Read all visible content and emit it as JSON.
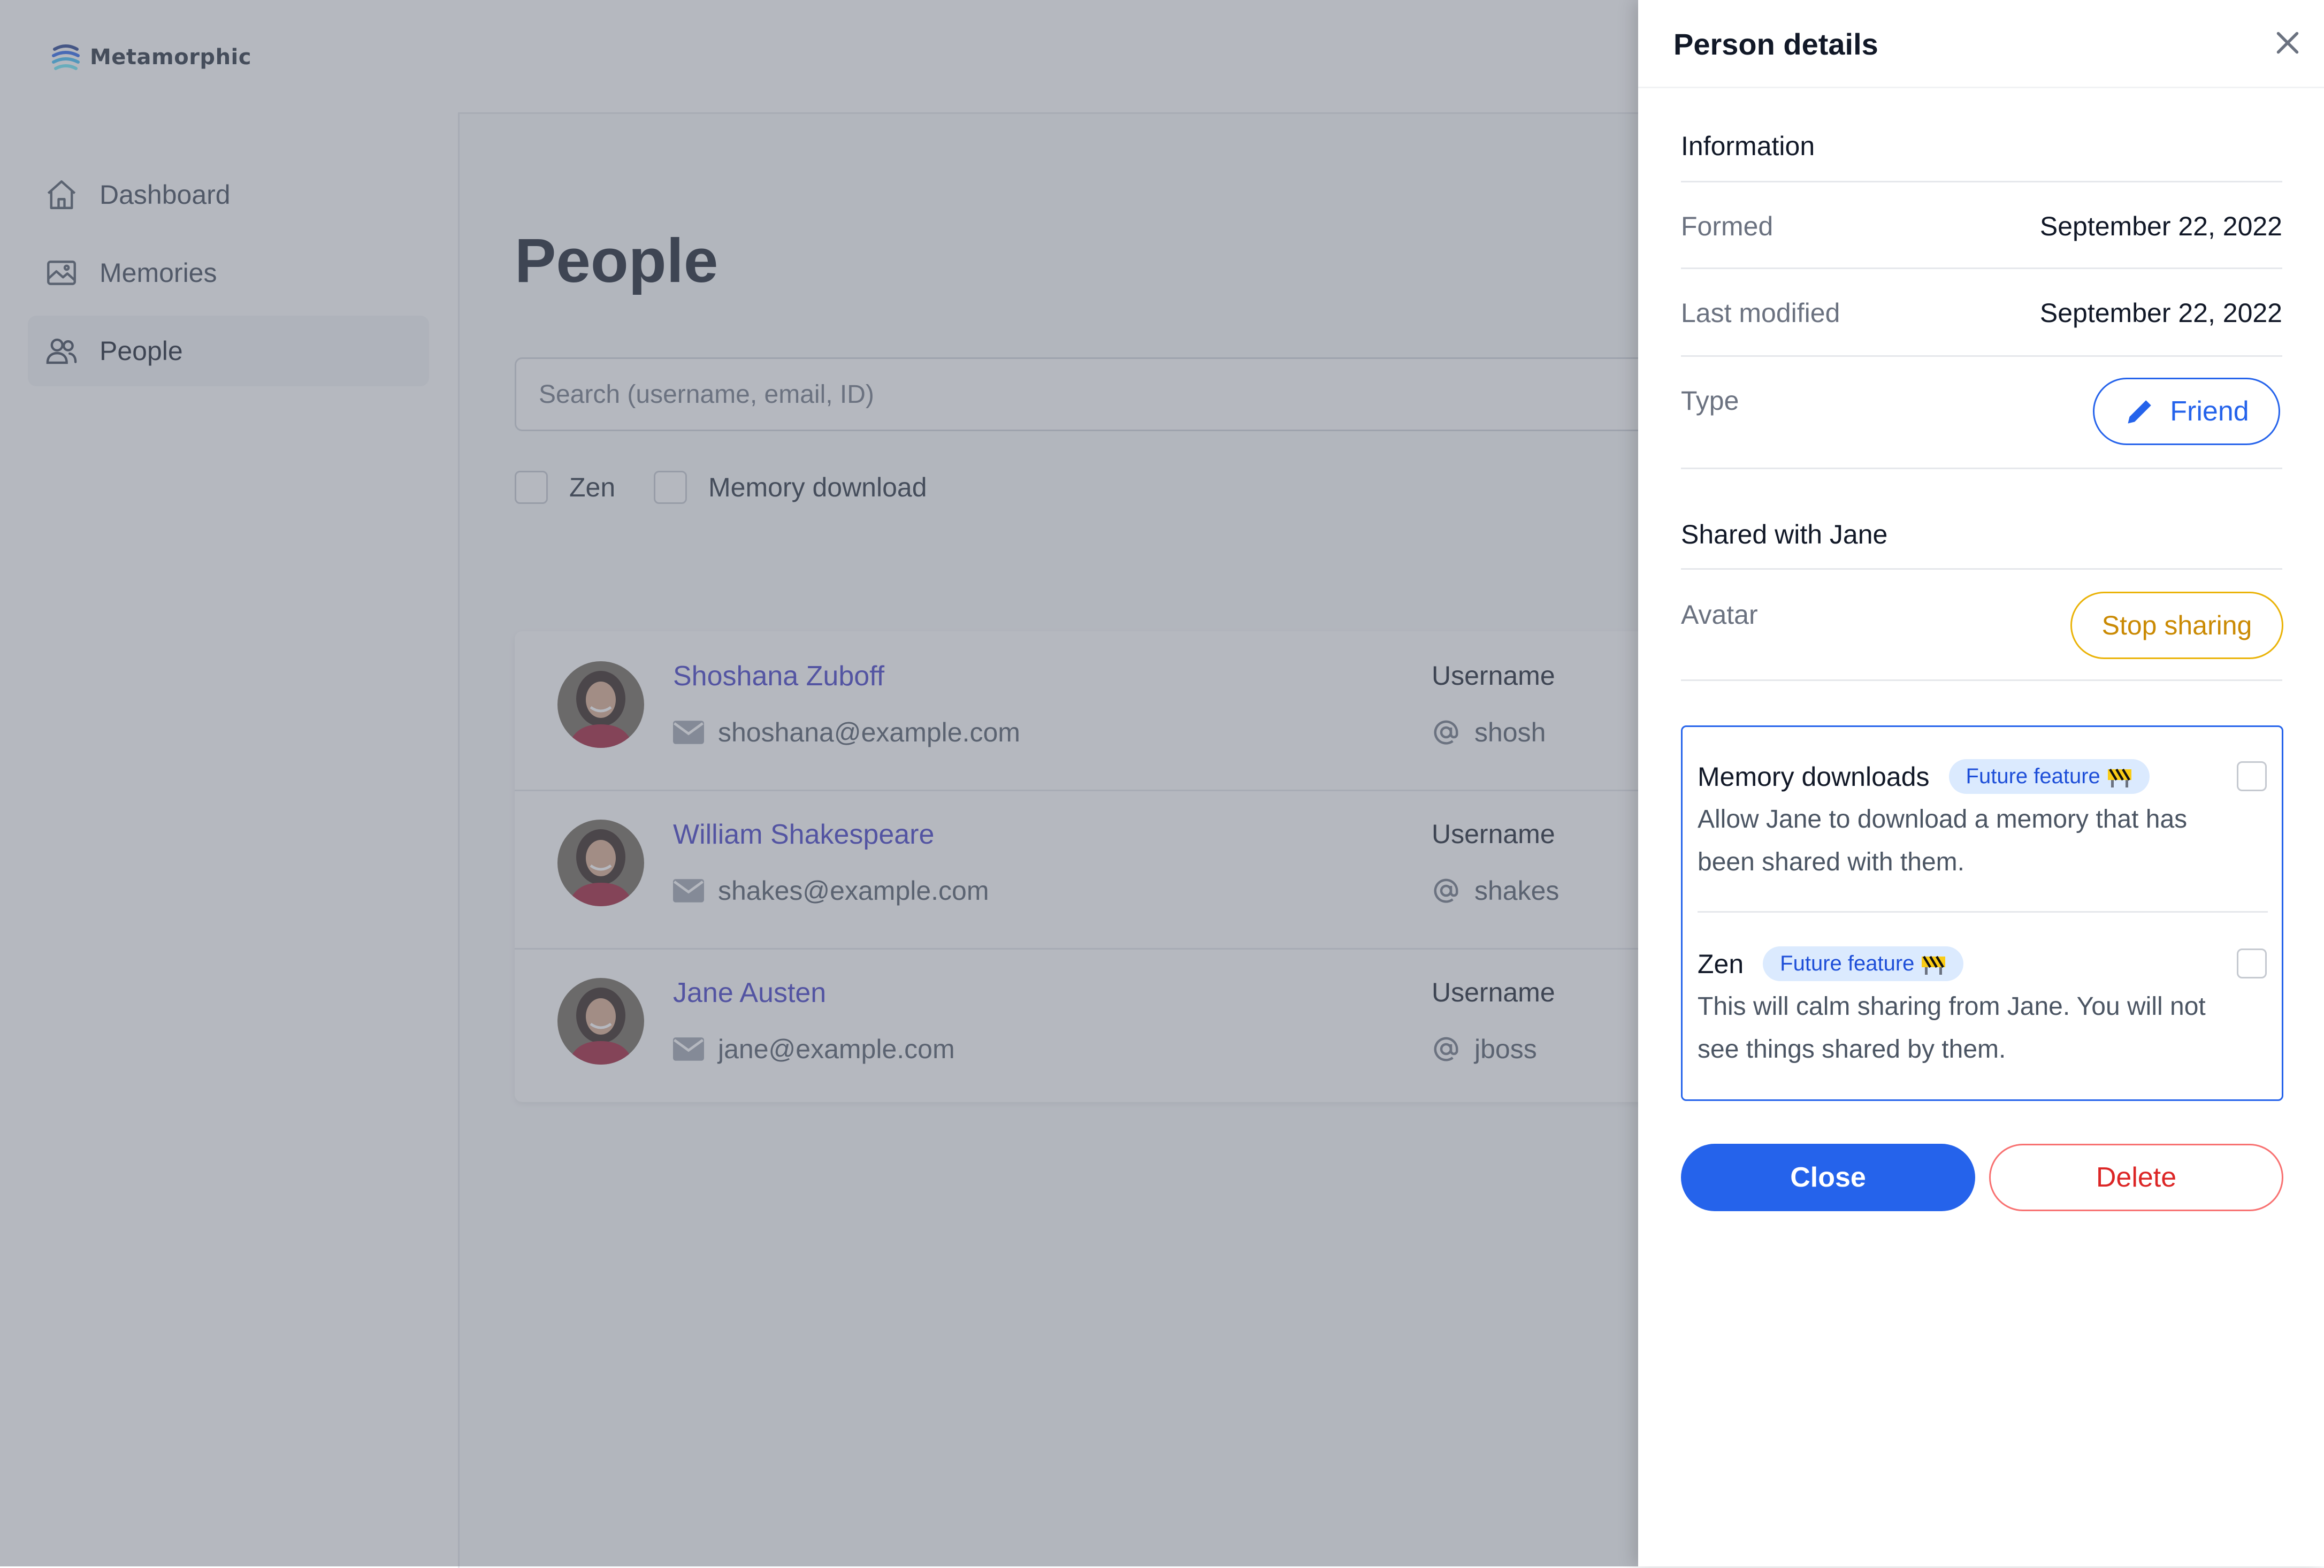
{
  "app": {
    "logo_text": "Metamorphic",
    "nav": [
      {
        "label": "Dashboard",
        "icon": "home-icon"
      },
      {
        "label": "Memories",
        "icon": "image-icon"
      },
      {
        "label": "People",
        "icon": "users-icon",
        "active": true
      }
    ]
  },
  "main": {
    "title": "People",
    "search_placeholder": "Search (username, email, ID)",
    "filters": [
      "Zen",
      "Memory download"
    ],
    "people": [
      {
        "name": "Shoshana Zuboff",
        "email": "shoshana@example.com",
        "username_label": "Username",
        "username": "shosh"
      },
      {
        "name": "William Shakespeare",
        "email": "shakes@example.com",
        "username_label": "Username",
        "username": "shakes"
      },
      {
        "name": "Jane Austen",
        "email": "jane@example.com",
        "username_label": "Username",
        "username": "jboss"
      }
    ]
  },
  "panel": {
    "title": "Person details",
    "information_heading": "Information",
    "formed_label": "Formed",
    "formed_value": "September 22, 2022",
    "modified_label": "Last modified",
    "modified_value": "September 22, 2022",
    "type_label": "Type",
    "type_value": "Friend",
    "shared_heading": "Shared with Jane",
    "avatar_label": "Avatar",
    "stop_sharing": "Stop sharing",
    "features": [
      {
        "title": "Memory downloads",
        "badge": "Future feature",
        "description": "Allow Jane to download a memory that has been shared with them."
      },
      {
        "title": "Zen",
        "badge": "Future feature",
        "description": "This will calm sharing from Jane. You will not see things shared by them."
      }
    ],
    "close_button": "Close",
    "delete_button": "Delete"
  },
  "colors": {
    "primary": "#2563eb",
    "danger": "#dc2626",
    "warning": "#ca8a04",
    "link": "#3b36c5",
    "overlay": "rgba(107,114,128,0.5)"
  }
}
